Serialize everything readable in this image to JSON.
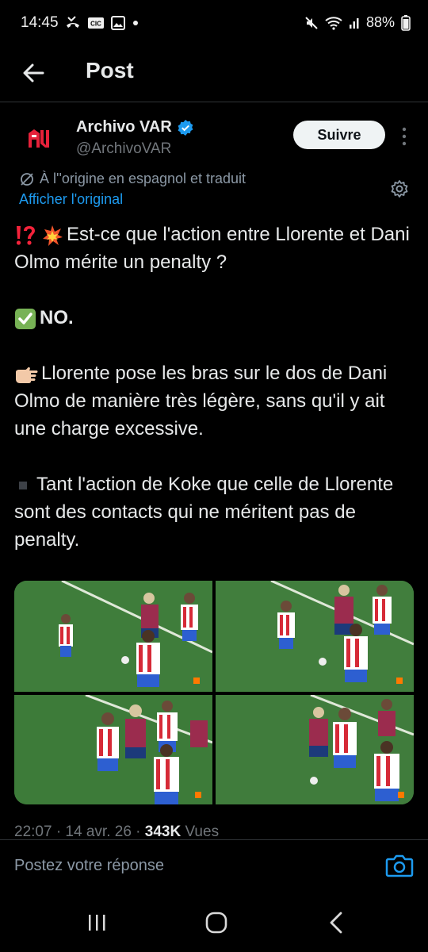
{
  "status_bar": {
    "time": "14:45",
    "battery": "88%",
    "icons_left": [
      "missed-call-icon",
      "cc-icon",
      "gallery-icon",
      "dot-icon"
    ],
    "icons_right": [
      "mute-icon",
      "wifi-icon",
      "signal-icon",
      "battery-icon"
    ]
  },
  "header": {
    "title": "Post",
    "back_icon": "arrow-left-icon"
  },
  "author": {
    "name": "Archivo VAR",
    "handle": "@ArchivoVAR",
    "verified": true,
    "follow_label": "Suivre"
  },
  "translation": {
    "note": "À l''origine en espagnol et traduit",
    "show_original": "Afficher l'original"
  },
  "tweet": {
    "p1": "Est-ce que l'action entre Llorente et Dani Olmo mérite un penalty ?",
    "p2": "NO.",
    "p3": "Llorente pose les bras sur le dos de Dani Olmo de manière très légère, sans qu'il y ait une charge excessive.",
    "p4": "Tant l'action de Koke que celle de Llorente sont des contacts qui ne méritent pas de penalty."
  },
  "meta": {
    "date": "22:07 · 14 avr. 26 · ",
    "views_count": "343K",
    "views_label": " Vues"
  },
  "reply": {
    "placeholder": "Postez votre réponse"
  },
  "colors": {
    "accent": "#1d9bf0",
    "background": "#000000",
    "text": "#e7e9ea",
    "muted": "#71767b",
    "pitch": "#3e7a3c"
  }
}
